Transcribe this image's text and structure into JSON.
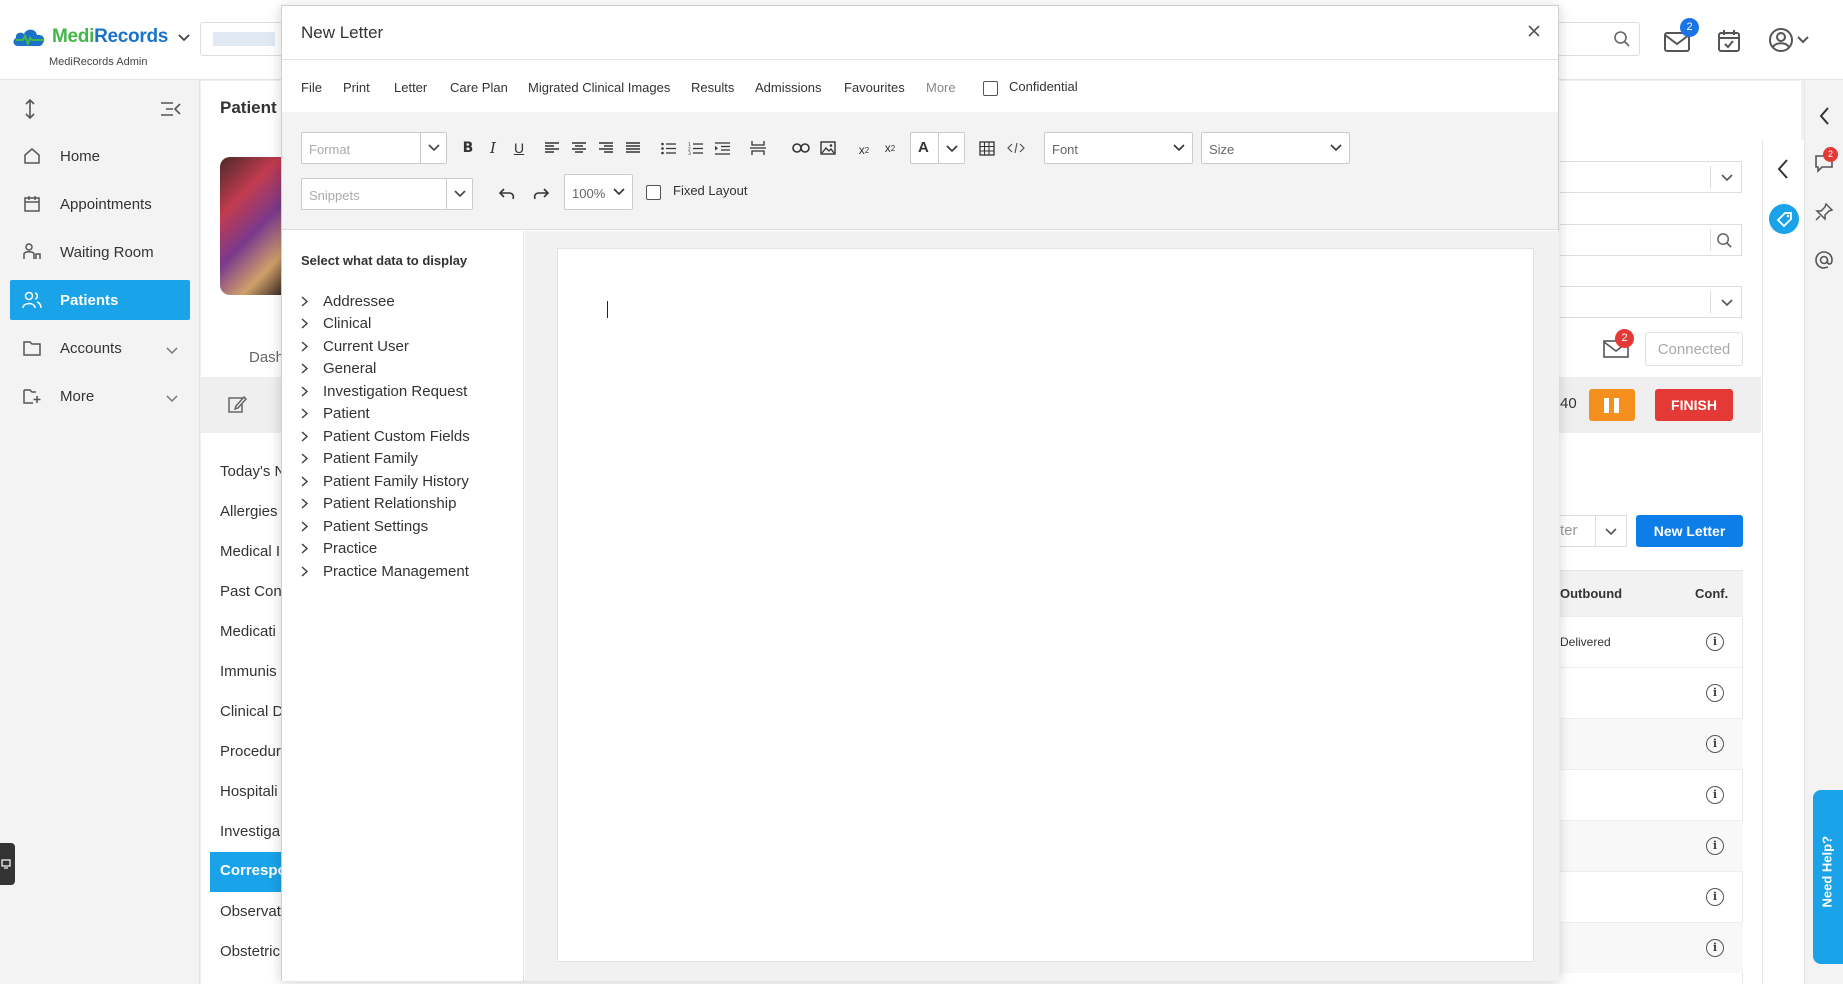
{
  "app": {
    "brand_part1": "Medi",
    "brand_part2": "Records",
    "subtitle": "MediRecords Admin",
    "mail_badge": "2",
    "colors": {
      "accent": "#1aa3e8",
      "brand_green": "#41b649",
      "brand_blue": "#1a73c8",
      "highlight": "#e00000",
      "finish": "#e53935",
      "pause": "#f5901e"
    }
  },
  "sidebar": {
    "items": [
      {
        "label": "Home",
        "icon": "home-icon"
      },
      {
        "label": "Appointments",
        "icon": "calendar-icon"
      },
      {
        "label": "Waiting Room",
        "icon": "waiting-room-icon"
      },
      {
        "label": "Patients",
        "icon": "patients-icon",
        "active": true
      },
      {
        "label": "Accounts",
        "icon": "folder-icon"
      },
      {
        "label": "More",
        "icon": "more-icon"
      }
    ]
  },
  "patient": {
    "title": "Patient",
    "dash_tab": "Dash",
    "left_list": [
      "Today's N",
      "Allergies",
      "Medical I",
      "Past Con",
      "Medicati",
      "Immunis",
      "Clinical D",
      "Procedur",
      "Hospitali",
      "Investiga",
      "Correspo",
      "Observat",
      "Obstetric"
    ],
    "timer_fragment": "40",
    "connected": "Connected",
    "finish": "FINISH",
    "msg_badge": "2",
    "filter_fragment": "ter",
    "new_letter_btn": "New Letter",
    "table_head_outbound": "Outbound",
    "table_head_conf": "Conf.",
    "first_row_status": "Delivered",
    "chat_badge": "2",
    "need_help": "Need Help?"
  },
  "modal": {
    "title": "New Letter",
    "menu": [
      "File",
      "Print",
      "Letter",
      "Care Plan",
      "Migrated Clinical Images",
      "Results",
      "Admissions",
      "Favourites",
      "More"
    ],
    "confidential": "Confidential",
    "toolbar": {
      "format_placeholder": "Format",
      "font_label": "Font",
      "size_label": "Size",
      "snippets_placeholder": "Snippets",
      "zoom": "100%",
      "fixed_layout": "Fixed Layout"
    },
    "data_panel": {
      "heading": "Select what data to display",
      "items": [
        "Addressee",
        "Clinical",
        "Current User",
        "General",
        "Investigation Request",
        "Patient",
        "Patient Custom Fields",
        "Patient Family",
        "Patient Family History",
        "Patient Relationship",
        "Patient Settings",
        "Practice",
        "Practice Management"
      ]
    }
  }
}
